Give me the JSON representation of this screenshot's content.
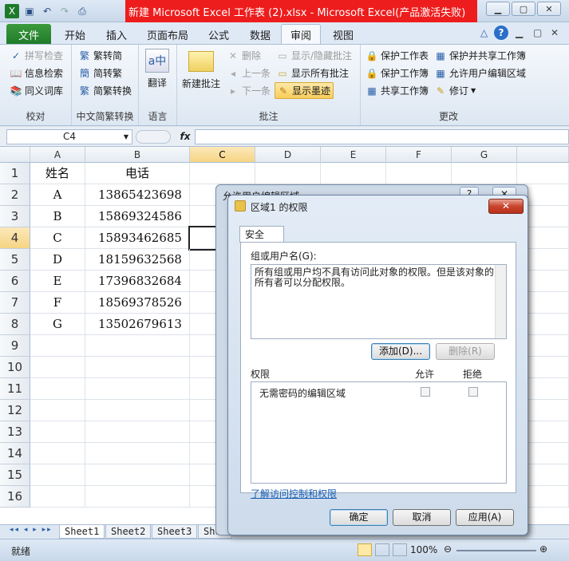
{
  "window": {
    "title": "新建 Microsoft Excel 工作表 (2).xlsx  -  Microsoft Excel(产品激活失败)"
  },
  "qat": {
    "save_icon": "save-icon",
    "undo_icon": "undo-icon",
    "redo_icon": "redo-icon"
  },
  "tabs": [
    {
      "label": "文件"
    },
    {
      "label": "开始"
    },
    {
      "label": "插入"
    },
    {
      "label": "页面布局"
    },
    {
      "label": "公式"
    },
    {
      "label": "数据"
    },
    {
      "label": "审阅"
    },
    {
      "label": "视图"
    }
  ],
  "ribbon": {
    "proofing": {
      "label": "校对",
      "spell": "拼写检查",
      "research": "信息检索",
      "thesaurus": "同义词库"
    },
    "chinese": {
      "label": "中文简繁转换",
      "to_simp": "繁转简",
      "to_trad": "简转繁",
      "convert": "简繁转换"
    },
    "language": {
      "label": "语言",
      "translate": "翻译"
    },
    "comments": {
      "label": "批注",
      "new": "新建批注",
      "delete": "删除",
      "prev": "上一条",
      "next": "下一条",
      "show_hide": "显示/隐藏批注",
      "show_all": "显示所有批注",
      "show_ink": "显示墨迹"
    },
    "changes": {
      "label": "更改",
      "protect_sheet": "保护工作表",
      "protect_book": "保护工作簿",
      "share_book": "共享工作簿",
      "protect_share": "保护并共享工作簿",
      "allow_edit": "允许用户编辑区域",
      "track": "修订"
    }
  },
  "formula": {
    "namebox": "C4",
    "fx": "fx"
  },
  "columns": [
    "A",
    "B",
    "C",
    "D",
    "E",
    "F",
    "G"
  ],
  "rows": [
    "1",
    "2",
    "3",
    "4",
    "5",
    "6",
    "7",
    "8",
    "9",
    "10",
    "11",
    "12",
    "13",
    "14",
    "15",
    "16"
  ],
  "cells": [
    [
      "姓名",
      "电话"
    ],
    [
      "A",
      "13865423698"
    ],
    [
      "B",
      "15869324586"
    ],
    [
      "C",
      "15893462685"
    ],
    [
      "D",
      "18159632568"
    ],
    [
      "E",
      "17396832684"
    ],
    [
      "F",
      "18569378526"
    ],
    [
      "G",
      "13502679613"
    ]
  ],
  "sheets": [
    "Sheet1",
    "Sheet2",
    "Sheet3",
    "Shee"
  ],
  "status": {
    "ready": "就绪",
    "zoom": "100%"
  },
  "dialog_back": {
    "title": "允许用户编辑区域",
    "help": "?",
    "close": "✕"
  },
  "dialog": {
    "title": "区域1 的权限",
    "close": "✕",
    "tab": "安全",
    "group_label": "组或用户名(G):",
    "group_text": "所有组或用户均不具有访问此对象的权限。但是该对象的所有者可以分配权限。",
    "add": "添加(D)...",
    "remove": "删除(R)",
    "perm_label": "权限",
    "allow": "允许",
    "deny": "拒绝",
    "perm_item": "无需密码的编辑区域",
    "link": "了解访问控制和权限",
    "ok": "确定",
    "cancel": "取消",
    "apply": "应用(A)"
  },
  "colors": {
    "title_red": "#ee1d1d",
    "file_green": "#1e7a2b",
    "select_yellow": "#f6d483"
  }
}
